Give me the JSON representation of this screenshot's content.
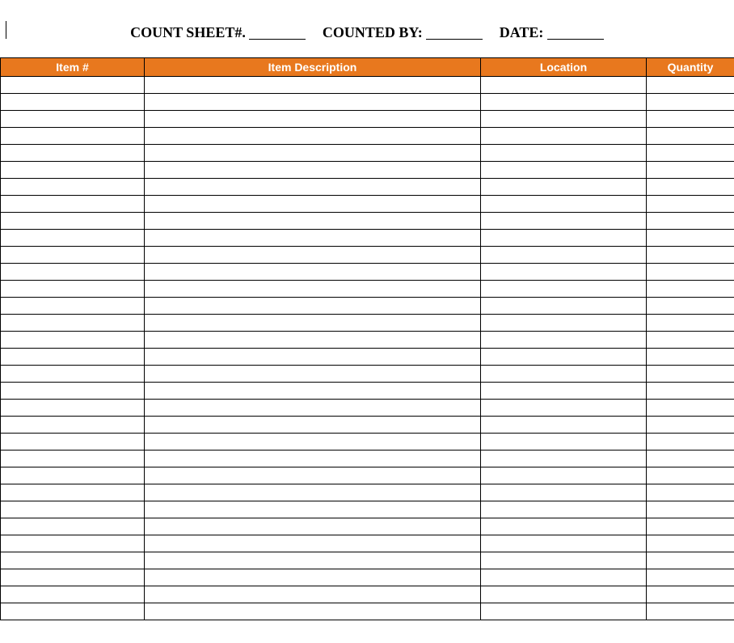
{
  "header": {
    "count_sheet_label": "COUNT SHEET#.",
    "count_sheet_value": "",
    "counted_by_label": "COUNTED BY:",
    "counted_by_value": "",
    "date_label": "DATE:",
    "date_value": ""
  },
  "table": {
    "columns": [
      {
        "label": "Item #"
      },
      {
        "label": "Item Description"
      },
      {
        "label": "Location"
      },
      {
        "label": "Quantity"
      }
    ],
    "rows": [
      {
        "item_no": "",
        "description": "",
        "location": "",
        "quantity": ""
      },
      {
        "item_no": "",
        "description": "",
        "location": "",
        "quantity": ""
      },
      {
        "item_no": "",
        "description": "",
        "location": "",
        "quantity": ""
      },
      {
        "item_no": "",
        "description": "",
        "location": "",
        "quantity": ""
      },
      {
        "item_no": "",
        "description": "",
        "location": "",
        "quantity": ""
      },
      {
        "item_no": "",
        "description": "",
        "location": "",
        "quantity": ""
      },
      {
        "item_no": "",
        "description": "",
        "location": "",
        "quantity": ""
      },
      {
        "item_no": "",
        "description": "",
        "location": "",
        "quantity": ""
      },
      {
        "item_no": "",
        "description": "",
        "location": "",
        "quantity": ""
      },
      {
        "item_no": "",
        "description": "",
        "location": "",
        "quantity": ""
      },
      {
        "item_no": "",
        "description": "",
        "location": "",
        "quantity": ""
      },
      {
        "item_no": "",
        "description": "",
        "location": "",
        "quantity": ""
      },
      {
        "item_no": "",
        "description": "",
        "location": "",
        "quantity": ""
      },
      {
        "item_no": "",
        "description": "",
        "location": "",
        "quantity": ""
      },
      {
        "item_no": "",
        "description": "",
        "location": "",
        "quantity": ""
      },
      {
        "item_no": "",
        "description": "",
        "location": "",
        "quantity": ""
      },
      {
        "item_no": "",
        "description": "",
        "location": "",
        "quantity": ""
      },
      {
        "item_no": "",
        "description": "",
        "location": "",
        "quantity": ""
      },
      {
        "item_no": "",
        "description": "",
        "location": "",
        "quantity": ""
      },
      {
        "item_no": "",
        "description": "",
        "location": "",
        "quantity": ""
      },
      {
        "item_no": "",
        "description": "",
        "location": "",
        "quantity": ""
      },
      {
        "item_no": "",
        "description": "",
        "location": "",
        "quantity": ""
      },
      {
        "item_no": "",
        "description": "",
        "location": "",
        "quantity": ""
      },
      {
        "item_no": "",
        "description": "",
        "location": "",
        "quantity": ""
      },
      {
        "item_no": "",
        "description": "",
        "location": "",
        "quantity": ""
      },
      {
        "item_no": "",
        "description": "",
        "location": "",
        "quantity": ""
      },
      {
        "item_no": "",
        "description": "",
        "location": "",
        "quantity": ""
      },
      {
        "item_no": "",
        "description": "",
        "location": "",
        "quantity": ""
      },
      {
        "item_no": "",
        "description": "",
        "location": "",
        "quantity": ""
      },
      {
        "item_no": "",
        "description": "",
        "location": "",
        "quantity": ""
      },
      {
        "item_no": "",
        "description": "",
        "location": "",
        "quantity": ""
      },
      {
        "item_no": "",
        "description": "",
        "location": "",
        "quantity": ""
      }
    ]
  },
  "colors": {
    "header_bg": "#e8781e",
    "header_fg": "#ffffff"
  }
}
